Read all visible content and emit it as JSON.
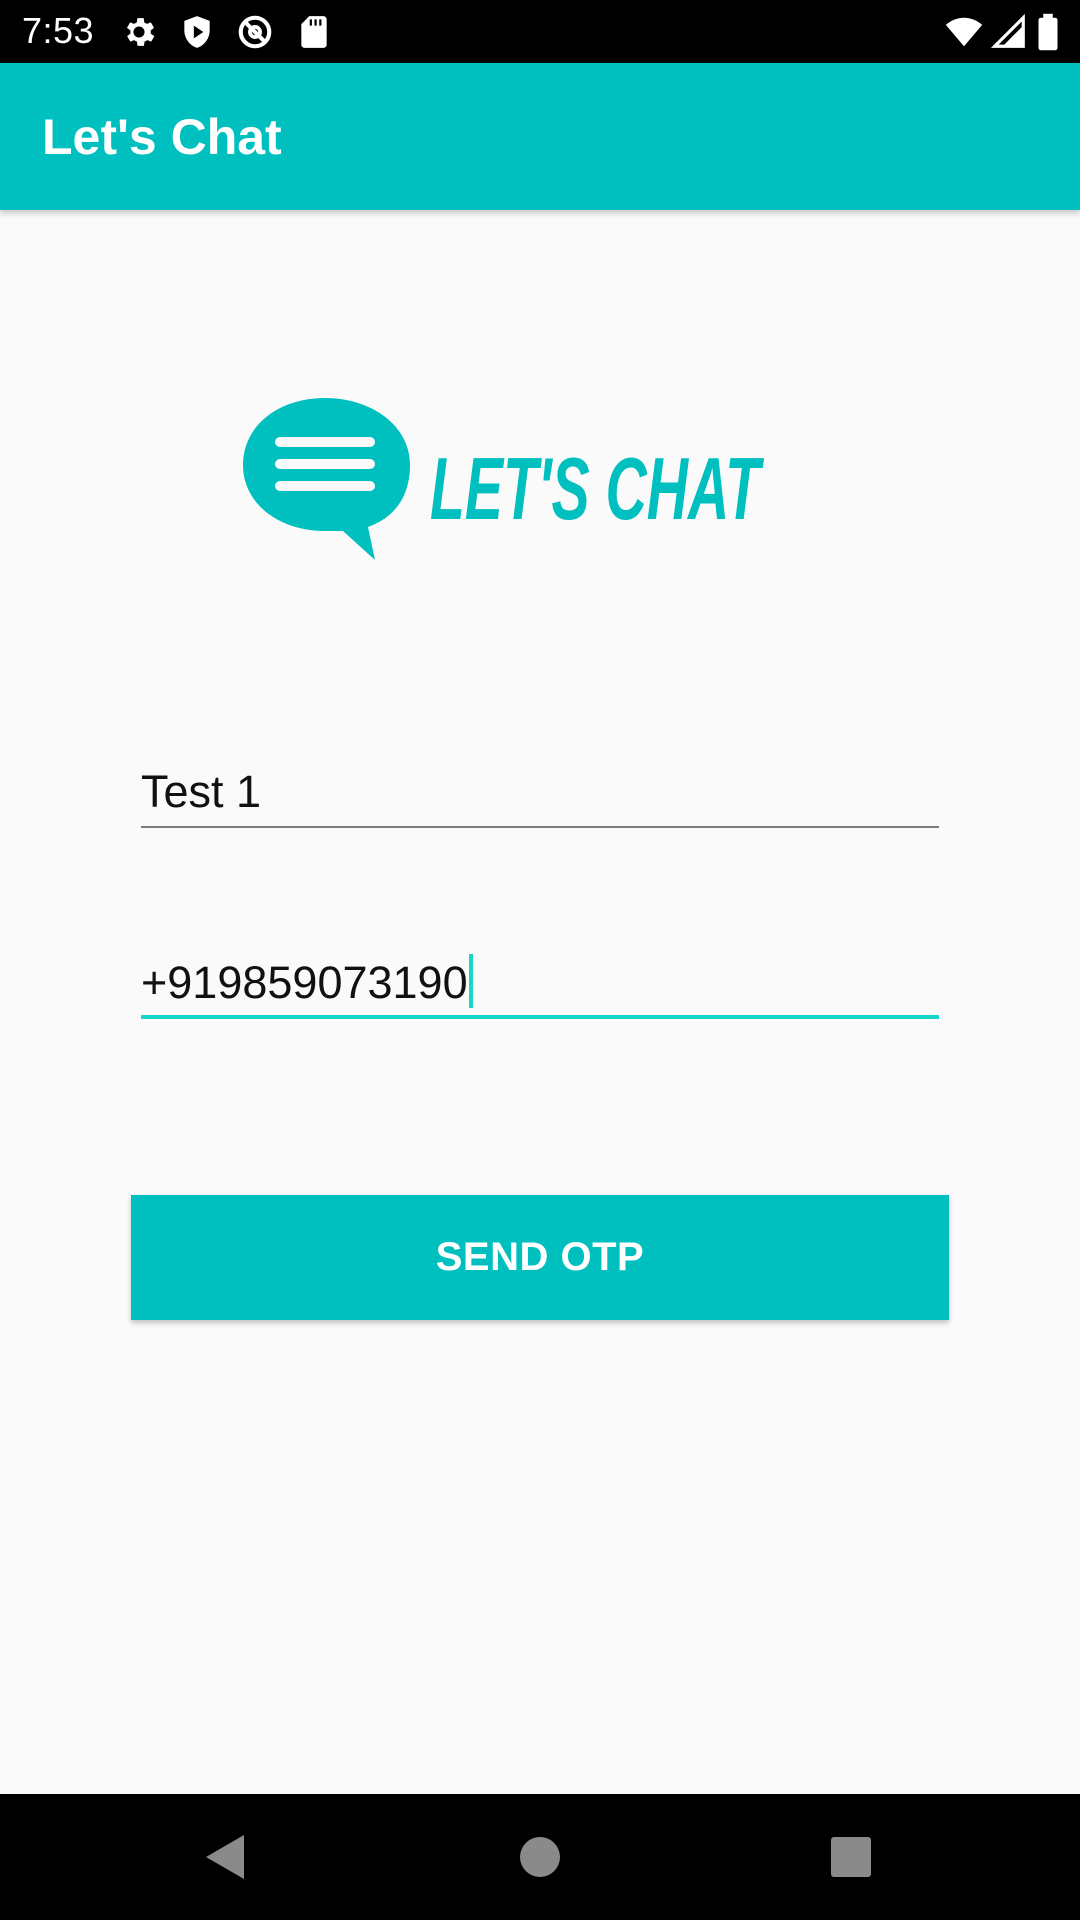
{
  "status_bar": {
    "time": "7:53",
    "left_icons": [
      "gear-icon",
      "shield-play-icon",
      "at-sign-icon",
      "sd-card-icon"
    ],
    "right_icons": [
      "wifi-icon",
      "cell-signal-icon",
      "battery-icon"
    ]
  },
  "app_bar": {
    "title": "Let's Chat",
    "color": "#00bfbf"
  },
  "logo": {
    "text": "LET'S CHAT",
    "icon": "chat-bubble-icon",
    "color": "#00bfbf"
  },
  "form": {
    "name_value": "Test 1",
    "phone_value": "+919859073190",
    "focus_color": "#16d6c9"
  },
  "send_button": {
    "label": "SEND OTP"
  },
  "nav_bar": {
    "icons": [
      "back-icon",
      "home-icon",
      "recents-icon"
    ]
  }
}
